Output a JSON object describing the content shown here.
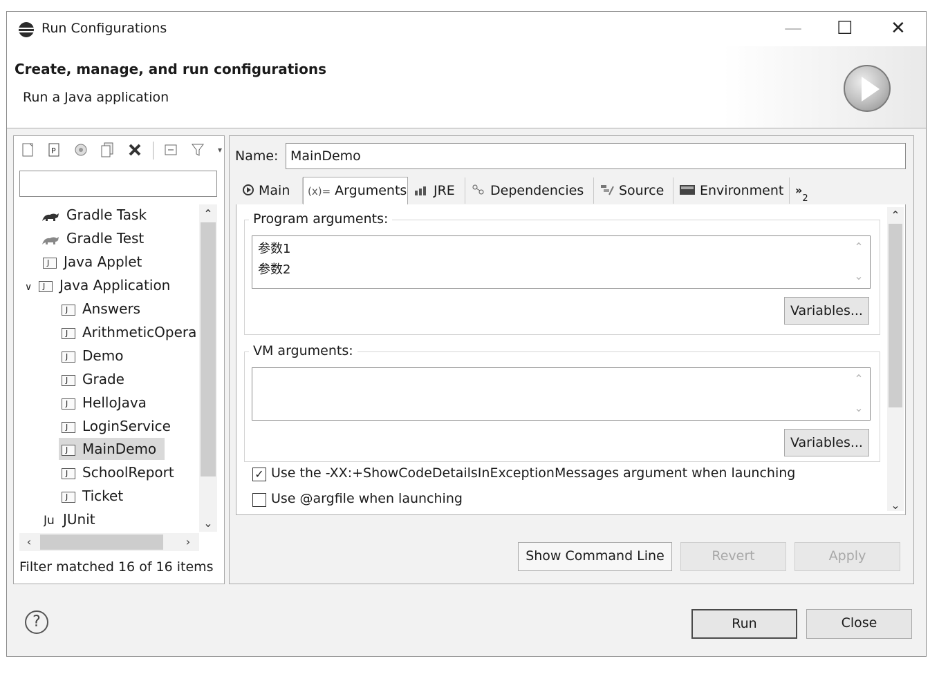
{
  "window": {
    "title": "Run Configurations",
    "controls": {
      "minimize": "—",
      "maximize": "☐",
      "close": "✕"
    }
  },
  "banner": {
    "title": "Create, manage, and run configurations",
    "subtitle": "Run a Java application"
  },
  "toolbar": {
    "icons": [
      "new-launch-config-icon",
      "new-prototype-icon",
      "export-icon",
      "duplicate-icon",
      "delete-icon",
      "collapse-all-icon",
      "filter-icon",
      "view-menu-icon"
    ]
  },
  "filter": {
    "placeholder": ""
  },
  "tree": {
    "items": [
      {
        "label": "Gradle Task",
        "icon": "gradle-icon",
        "level": 1
      },
      {
        "label": "Gradle Test",
        "icon": "gradle-icon",
        "level": 1
      },
      {
        "label": "Java Applet",
        "icon": "applet-icon",
        "level": 1
      },
      {
        "label": "Java Application",
        "icon": "java-app-icon",
        "level": 1,
        "expanded": true
      },
      {
        "label": "Answers",
        "icon": "java-app-icon",
        "level": 2
      },
      {
        "label": "ArithmeticOpera",
        "icon": "java-app-icon",
        "level": 2
      },
      {
        "label": "Demo",
        "icon": "java-app-icon",
        "level": 2
      },
      {
        "label": "Grade",
        "icon": "java-app-icon",
        "level": 2
      },
      {
        "label": "HelloJava",
        "icon": "java-app-icon",
        "level": 2
      },
      {
        "label": "LoginService",
        "icon": "java-app-icon",
        "level": 2
      },
      {
        "label": "MainDemo",
        "icon": "java-app-icon",
        "level": 2,
        "selected": true
      },
      {
        "label": "SchoolReport",
        "icon": "java-app-icon",
        "level": 2
      },
      {
        "label": "Ticket",
        "icon": "java-app-icon",
        "level": 2
      },
      {
        "label": "JUnit",
        "icon": "junit-icon",
        "level": 1
      }
    ],
    "junit_prefix": "Ju",
    "filter_status": "Filter matched 16 of 16 items"
  },
  "config": {
    "name_label": "Name:",
    "name_value": "MainDemo",
    "tabs": [
      {
        "label": "Main",
        "icon": "main-tab-icon"
      },
      {
        "label": "Arguments",
        "icon": "arguments-tab-icon",
        "active": true,
        "glyph": "(x)="
      },
      {
        "label": "JRE",
        "icon": "jre-tab-icon"
      },
      {
        "label": "Dependencies",
        "icon": "dependencies-tab-icon"
      },
      {
        "label": "Source",
        "icon": "source-tab-icon"
      },
      {
        "label": "Environment",
        "icon": "environment-tab-icon"
      }
    ],
    "more_tabs": "»",
    "more_tabs_count": "2",
    "program_args_label": "Program arguments:",
    "program_args_lines": [
      "参数1",
      "参数2"
    ],
    "vm_args_label": "VM arguments:",
    "vm_args_value": "",
    "variables_label": "Variables...",
    "checkbox_show_code": {
      "label": "Use the -XX:+ShowCodeDetailsInExceptionMessages argument when launching",
      "checked": true
    },
    "checkbox_argfile": {
      "label": "Use @argfile when launching",
      "checked": false
    }
  },
  "buttons": {
    "show_command_line": "Show Command Line",
    "revert": "Revert",
    "apply": "Apply",
    "run": "Run",
    "close": "Close"
  },
  "colors": {
    "window_bg": "#f2f2f2",
    "selection_bg": "#d9d9d9",
    "disabled_text": "#a8a8a8"
  }
}
